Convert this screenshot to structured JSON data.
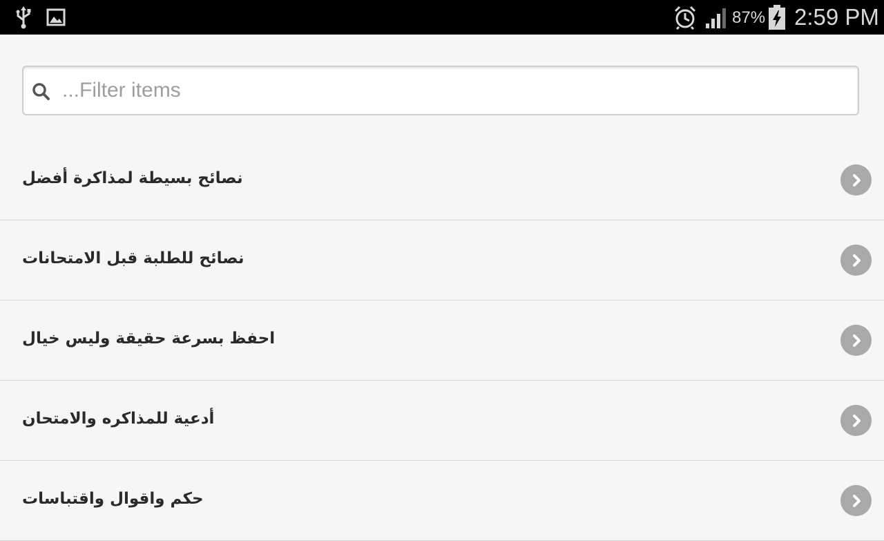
{
  "status_bar": {
    "battery_percent": "87%",
    "time": "2:59 PM",
    "icons": [
      "usb-icon",
      "image-icon",
      "alarm-icon",
      "signal-icon",
      "battery-charging-icon"
    ]
  },
  "search": {
    "placeholder": "...Filter items",
    "value": ""
  },
  "list": {
    "items": [
      {
        "label": "نصائح بسيطة لمذاكرة أفضل"
      },
      {
        "label": "نصائح للطلبة قبل الامتحانات"
      },
      {
        "label": "احفظ بسرعة حقيقة وليس خيال"
      },
      {
        "label": "أدعية للمذاكره والامتحان"
      },
      {
        "label": "حكم واقوال واقتباسات"
      }
    ]
  },
  "colors": {
    "status_bar_bg": "#000000",
    "page_bg": "#f6f6f6",
    "chevron_bg": "#a9a9a9",
    "text": "#2a2a2a"
  }
}
